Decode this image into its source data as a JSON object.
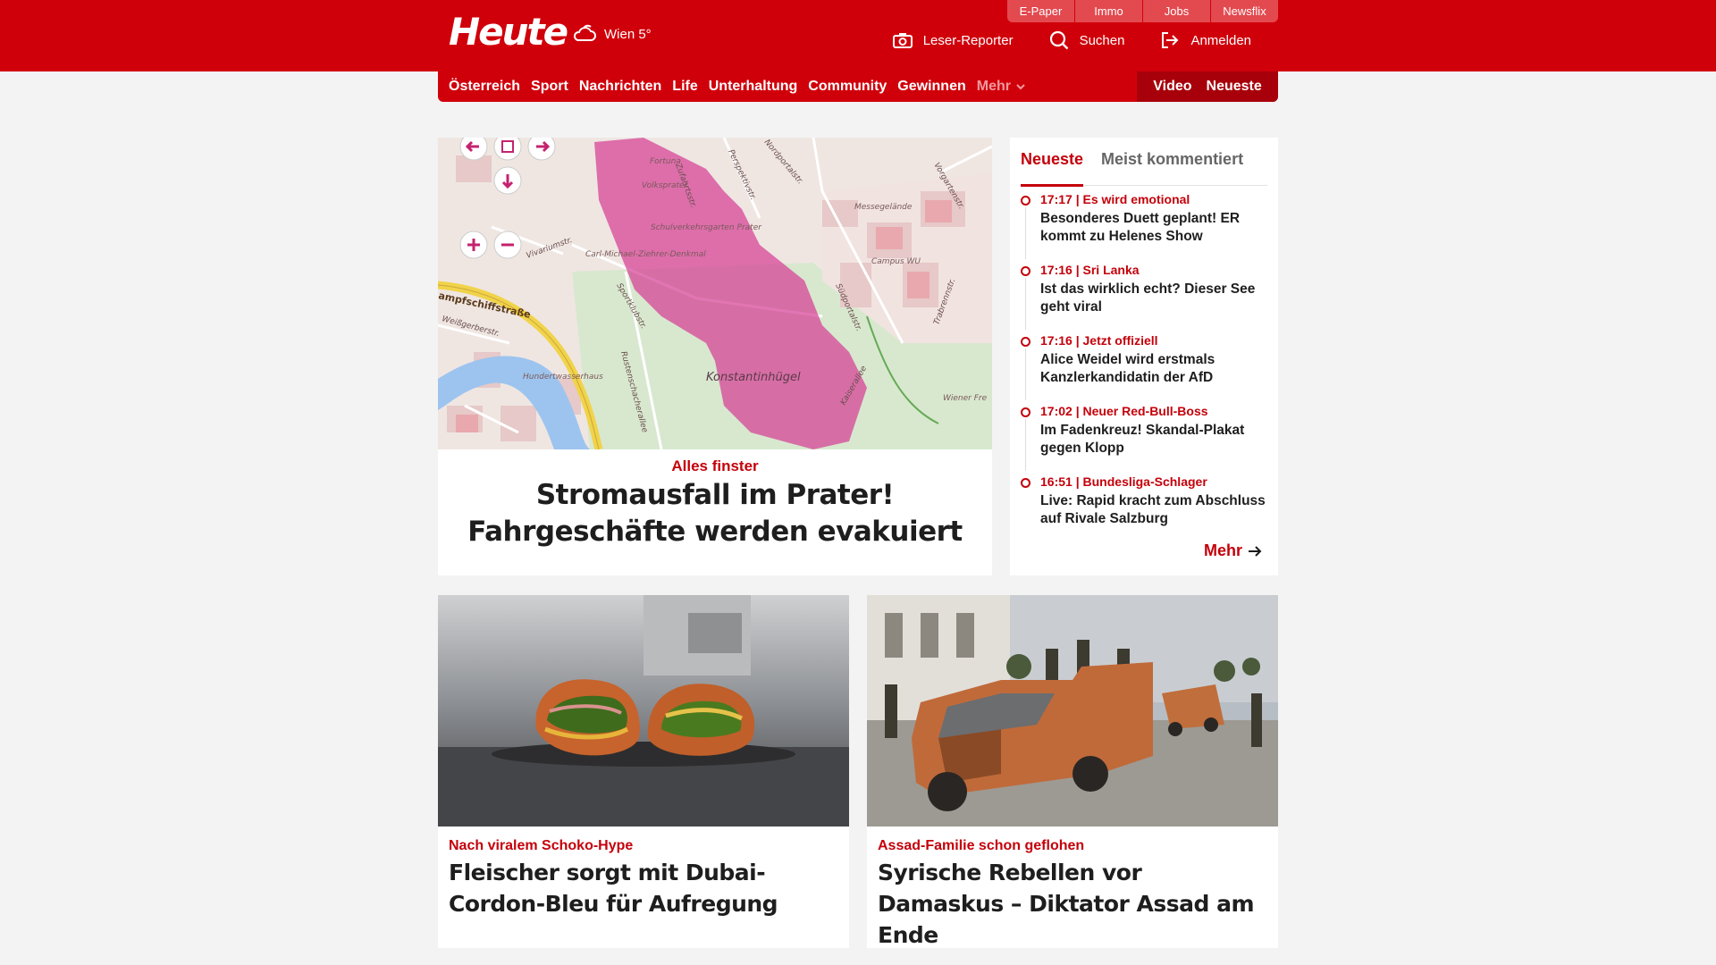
{
  "header": {
    "logo": "Heute",
    "weather": "Wien 5°",
    "service_links": [
      "E-Paper",
      "Immo",
      "Jobs",
      "Newsflix"
    ],
    "tools": {
      "reporter": "Leser-Reporter",
      "search": "Suchen",
      "login": "Anmelden"
    }
  },
  "nav": {
    "items": [
      "Österreich",
      "Sport",
      "Nachrichten",
      "Life",
      "Unterhaltung",
      "Community",
      "Gewinnen"
    ],
    "more": "Mehr",
    "video": "Video",
    "latest": "Neueste"
  },
  "top_story": {
    "kicker": "Alles finster",
    "headline": "Stromausfall im Prater! Fahrgeschäfte werden evakuiert",
    "map_labels": {
      "fortuna": "Fortuna",
      "volksprater": "Volksprater",
      "verkehrsgarten": "Schulverkehrsgarten Prater",
      "campus": "Campus WU",
      "messe": "Messegelände",
      "konstantin": "Konstantinhügel",
      "dampf": "ampfschiffstraße",
      "weiss": "Weißgerberstr.",
      "vivarium": "Vivariumstr.",
      "sportklub": "Sportklubstr.",
      "suedportal": "Südportalstr.",
      "kaiserallee": "Kaiserallee",
      "hundertwasser": "Hundertwasserhaus",
      "rustenschacher": "Rustenschacherallee",
      "perspektiv": "Perspektivstr.",
      "ziehrer": "Carl-Michael-Ziehrer-Denkmal",
      "vorgarten": "Vorgartenstr.",
      "trabrenn": "Trabrennstr.",
      "wiener": "Wiener Fre",
      "zufahrt": "Zufahrtsstr.",
      "nordportal": "Nordportalstr."
    }
  },
  "sidebar": {
    "tabs": [
      "Neueste",
      "Meist kommentiert"
    ],
    "items": [
      {
        "time": "17:17",
        "tag": "Es wird emotional",
        "title": "Besonderes Duett geplant! ER kommt zu Helenes Show"
      },
      {
        "time": "17:16",
        "tag": "Sri Lanka",
        "title": "Ist das wirklich echt? Dieser See geht viral"
      },
      {
        "time": "17:16",
        "tag": "Jetzt offiziell",
        "title": "Alice Weidel wird erstmals Kanzlerkandidatin der AfD"
      },
      {
        "time": "17:02",
        "tag": "Neuer Red-Bull-Boss",
        "title": "Im Fadenkreuz! Skandal-Plakat gegen Klopp"
      },
      {
        "time": "16:51",
        "tag": "Bundesliga-Schlager",
        "title": "Live: Rapid kracht zum Abschluss auf Rivale Salzburg"
      }
    ],
    "more": "Mehr"
  },
  "cards": [
    {
      "kicker": "Nach viralem Schoko-Hype",
      "headline": "Fleischer sorgt mit Dubai-Cordon-Bleu für Aufregung"
    },
    {
      "kicker": "Assad-Familie schon geflohen",
      "headline": "Syrische Rebellen vor Damaskus – Diktator Assad am Ende"
    }
  ],
  "colors": {
    "brand_red": "#d0000b",
    "accent_red": "#c4000a",
    "dark_red": "#a8000a",
    "background": "#f3f3f3"
  },
  "icons": [
    "weather-cloud-icon",
    "camera-icon",
    "search-icon",
    "logout-icon",
    "chevron-down-icon",
    "arrow-right-icon"
  ]
}
